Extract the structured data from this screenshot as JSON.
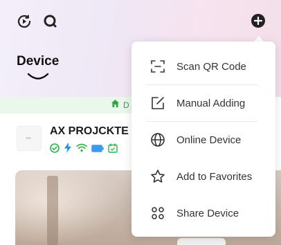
{
  "header": {
    "title": "Device",
    "icons": [
      "play-circle-icon",
      "search-icon",
      "plus-circle-icon"
    ]
  },
  "banner": {
    "icon": "home-icon",
    "text": "D"
  },
  "device": {
    "name": "AX PROJCKTE",
    "status_icons": [
      "check-circle-icon",
      "lightning-icon",
      "wifi-icon",
      "battery-icon",
      "calendar-icon"
    ]
  },
  "menu": {
    "items": [
      {
        "icon": "scan-qr-icon",
        "label": "Scan QR Code"
      },
      {
        "icon": "edit-icon",
        "label": "Manual Adding"
      },
      {
        "icon": "globe-icon",
        "label": "Online Device"
      },
      {
        "icon": "star-icon",
        "label": "Add to Favorites"
      },
      {
        "icon": "share-icon",
        "label": "Share Device"
      }
    ]
  },
  "colors": {
    "accent_green": "#2fa34c",
    "status_icons": "#27b34a",
    "lightning": "#1e8ff0",
    "dark": "#222222"
  }
}
